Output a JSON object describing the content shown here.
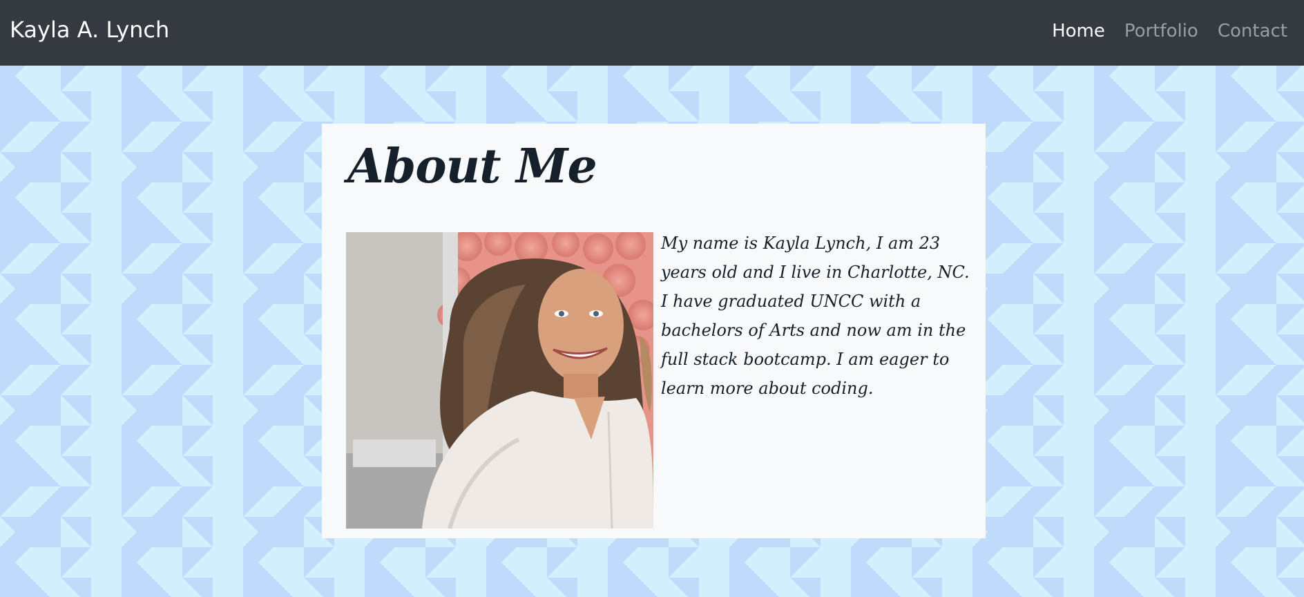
{
  "navbar": {
    "brand": "Kayla A. Lynch",
    "links": [
      {
        "label": "Home",
        "active": true
      },
      {
        "label": "Portfolio",
        "active": false
      },
      {
        "label": "Contact",
        "active": false
      }
    ]
  },
  "about": {
    "title": "About Me",
    "bio": "My name is Kayla Lynch, I am 23 years old and I live in Charlotte, NC. I have graduated UNCC with a bachelors of Arts and now am in the full stack bootcamp. I am eager to learn more about coding."
  },
  "colors": {
    "navbar_bg": "#343a40",
    "page_bg_light": "#d2effd",
    "page_bg_pattern": "#c0dafb",
    "card_bg": "#f8f9fa",
    "text_dark": "#15202b"
  },
  "icons": {
    "profile_photo": "portrait-photo"
  }
}
